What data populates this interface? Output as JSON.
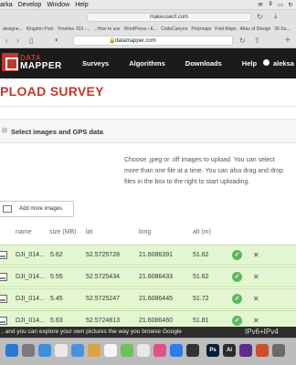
{
  "menubar": {
    "items": [
      "arka",
      "Develop",
      "Window",
      "Help"
    ],
    "status_badge": "9"
  },
  "browser": {
    "tab_url": "makeuseof.com",
    "bookmarks": [
      "designe...",
      "Kingdon Pool",
      "Timeline JS3 -...",
      "...How to use",
      "WordPress › E...",
      "CodeCanyon",
      "Polymaps",
      "Fold Maps",
      "Atlas of Design",
      "30 Su..."
    ],
    "address": "datamapper.com"
  },
  "site": {
    "logo_top": "DATA",
    "logo_bottom": "MAPPER",
    "nav": [
      "Surveys",
      "Algorithms",
      "Downloads",
      "Help"
    ],
    "user": "aleksa"
  },
  "page": {
    "title": "PLOAD SURVEY",
    "section_title": "Select images and GPS data",
    "instructions": "Choose .jpeg or .tiff images to upload. You can select more than one file at a time. You can also drag and drop files in the box to the right to start uploading.",
    "add_button": "Add more images"
  },
  "table": {
    "columns": [
      "name",
      "size (MB)",
      "lat",
      "long",
      "alt (m)"
    ],
    "rows": [
      {
        "name": "DJI_014...",
        "size": "5.62",
        "lat": "52.5725728",
        "long": "21.6086391",
        "alt": "51.62"
      },
      {
        "name": "DJI_014...",
        "size": "5.55",
        "lat": "52.5725434",
        "long": "21.6086433",
        "alt": "51.62"
      },
      {
        "name": "DJI_014...",
        "size": "5.45",
        "lat": "52.5725247",
        "long": "21.6086445",
        "alt": "51.72"
      },
      {
        "name": "DJI_014...",
        "size": "5.63",
        "lat": "52.5724813",
        "long": "21.6086460",
        "alt": "51.81"
      }
    ]
  },
  "overlay": {
    "caption": ", and you can explore your own pictures the way you browse Google",
    "ipv": "IPv6+IPv4"
  },
  "colors": {
    "brand_red": "#c0392b",
    "row_green": "#e3f6d1",
    "ok_green": "#5cb85c",
    "header_dark": "#1b1b1b"
  }
}
